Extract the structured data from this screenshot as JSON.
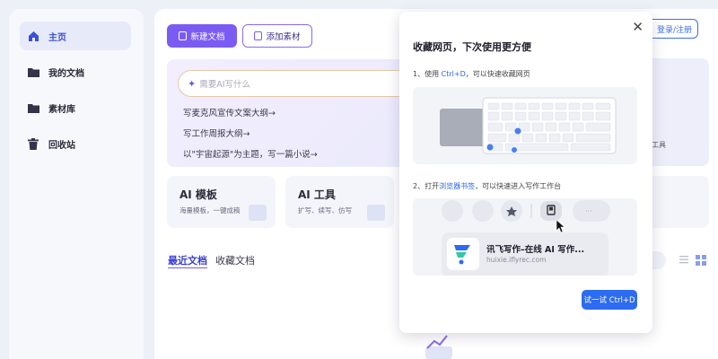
{
  "sidebar": {
    "items": [
      {
        "label": "主页",
        "icon": "home-icon",
        "active": true
      },
      {
        "label": "我的文档",
        "icon": "folder-icon"
      },
      {
        "label": "素材库",
        "icon": "folder-icon"
      },
      {
        "label": "回收站",
        "icon": "trash-icon"
      }
    ]
  },
  "toolbar": {
    "new_doc": "新建文档",
    "add_material": "添加素材",
    "login": "登录/注册"
  },
  "hero": {
    "placeholder": "需要AI写什么",
    "suggestions": [
      "写麦克风宣传文案大纲→",
      "写工作周报大纲→",
      "以\"宇宙起源\"为主题，写一篇小说→"
    ],
    "right_fragment": "工具"
  },
  "cards": [
    {
      "title": "AI 模板",
      "subtitle": "海量模板，一键成稿"
    },
    {
      "title": "AI 工具",
      "subtitle": "扩写、续写、仿写"
    }
  ],
  "tabs": [
    {
      "label": "最近文档",
      "active": true
    },
    {
      "label": "收藏文档",
      "active": false
    }
  ],
  "popup": {
    "title": "收藏网页，下次使用更方便",
    "step1_prefix": "1、使用 ",
    "step1_key": "Ctrl+D",
    "step1_suffix": "，可以快速收藏网页",
    "step2_prefix": "2、打开",
    "step2_link": "浏览器书签",
    "step2_suffix": "，可以快速进入写作工作台",
    "bookmark_title": "讯飞写作–在线 AI 写作...",
    "bookmark_url": "huixie.iflyrec.com",
    "try_button": "试一试 Ctrl+D"
  },
  "colors": {
    "accent": "#7b5cf3",
    "primary_blue": "#2d6cf0"
  }
}
